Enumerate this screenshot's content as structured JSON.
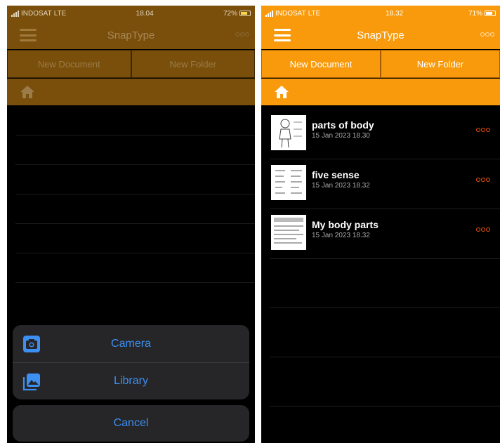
{
  "left_phone": {
    "status": {
      "carrier": "INDOSAT",
      "network": "LTE",
      "time": "18.04",
      "battery": "72%"
    },
    "app_title": "SnapType",
    "new_document_label": "New Document",
    "new_folder_label": "New Folder",
    "action_sheet": {
      "camera_label": "Camera",
      "library_label": "Library",
      "cancel_label": "Cancel"
    }
  },
  "right_phone": {
    "status": {
      "carrier": "INDOSAT",
      "network": "LTE",
      "time": "18.32",
      "battery": "71%"
    },
    "app_title": "SnapType",
    "new_document_label": "New Document",
    "new_folder_label": "New Folder",
    "documents": [
      {
        "title": "parts of body",
        "date": "15 Jan 2023 18.30"
      },
      {
        "title": "five sense",
        "date": "15 Jan 2023 18.32"
      },
      {
        "title": "My body parts",
        "date": "15 Jan 2023 18.32"
      }
    ]
  },
  "colors": {
    "accent": "#f89a0c",
    "accent_dimmed": "#7a4f0b",
    "sheet_link": "#3d8ff2",
    "more_dots": "#f0530f"
  },
  "icons": [
    "menu-icon",
    "more-icon",
    "home-icon",
    "camera-icon",
    "photo-library-icon"
  ]
}
